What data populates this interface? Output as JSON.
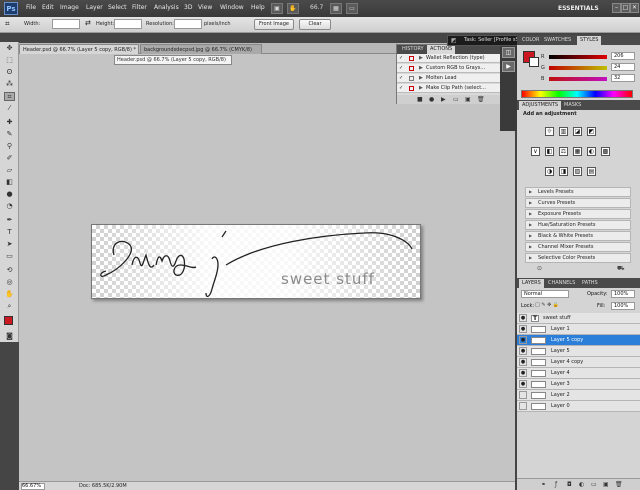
{
  "app": {
    "logo": "Ps",
    "zoom": "66.7",
    "workspace": "ESSENTIALS"
  },
  "menu": [
    "File",
    "Edit",
    "Image",
    "Layer",
    "Select",
    "Filter",
    "Analysis",
    "3D",
    "View",
    "Window",
    "Help"
  ],
  "window_buttons": [
    "–",
    "□",
    "✕"
  ],
  "options": {
    "width_label": "Width:",
    "height_label": "Height:",
    "resolution_label": "Resolution:",
    "resolution_unit": "pixels/inch",
    "front_image": "Front Image",
    "clear": "Clear"
  },
  "tabs": [
    {
      "label": "Header.psd @ 66.7% (Layer 5 copy, RGB/8) *",
      "active": true
    },
    {
      "label": "backgroundsdecpsd.jpg @ 66.7% (CMYK/8)",
      "active": false
    }
  ],
  "tooltip": "Header.psd @ 66.7% (Layer 5 copy, RGB/8)",
  "canvas": {
    "overlay_text": "sweet stuff"
  },
  "status": {
    "zoom": "66.67%",
    "doc": "Doc: 685.5K/2.90M"
  },
  "task": {
    "label": "Task: Seller [Profile sSocial]"
  },
  "actions_panel": {
    "tabs": [
      "HISTORY",
      "ACTIONS"
    ],
    "rows": [
      "Wallet Reflection (type)",
      "Custom RGB to Grays...",
      "Molten Lead",
      "Make Clip Path (select..."
    ]
  },
  "color_panel": {
    "tabs": [
      "COLOR",
      "SWATCHES",
      "STYLES"
    ],
    "sliders": [
      {
        "label": "R",
        "value": "206",
        "color": "#e00000"
      },
      {
        "label": "G",
        "value": "24",
        "color": "#00b000"
      },
      {
        "label": "B",
        "value": "32",
        "color": "#2040ff"
      }
    ],
    "foreground": "#cc1820"
  },
  "adjustments": {
    "tabs": [
      "ADJUSTMENTS",
      "MASKS"
    ],
    "add_label": "Add an adjustment",
    "row1": [
      "☼",
      "▥",
      "◪",
      "◩"
    ],
    "row2": [
      "∨",
      "◧",
      "⚖",
      "▦",
      "◐",
      "▩"
    ],
    "row3": [
      "◑",
      "◨",
      "▨",
      "▤"
    ],
    "presets": [
      "Levels Presets",
      "Curves Presets",
      "Exposure Presets",
      "Hue/Saturation Presets",
      "Black & White Presets",
      "Channel Mixer Presets",
      "Selective Color Presets"
    ]
  },
  "layers_panel": {
    "tabs": [
      "LAYERS",
      "CHANNELS",
      "PATHS"
    ],
    "blend_mode": "Normal",
    "opacity_label": "Opacity:",
    "opacity": "100%",
    "lock_label": "Lock:",
    "fill_label": "Fill:",
    "fill": "100%",
    "layers": [
      {
        "name": "sweet stuff",
        "type": "text",
        "visible": true,
        "selected": false
      },
      {
        "name": "Layer 1",
        "type": "image",
        "visible": true,
        "selected": false
      },
      {
        "name": "Layer 5 copy",
        "type": "image",
        "visible": true,
        "selected": true
      },
      {
        "name": "Layer 5",
        "type": "image",
        "visible": true,
        "selected": false
      },
      {
        "name": "Layer 4 copy",
        "type": "image",
        "visible": true,
        "selected": false
      },
      {
        "name": "Layer 4",
        "type": "image",
        "visible": true,
        "selected": false
      },
      {
        "name": "Layer 3",
        "type": "image",
        "visible": true,
        "selected": false
      },
      {
        "name": "Layer 2",
        "type": "image",
        "visible": false,
        "selected": false
      },
      {
        "name": "Layer 0",
        "type": "image",
        "visible": false,
        "selected": false
      }
    ]
  }
}
